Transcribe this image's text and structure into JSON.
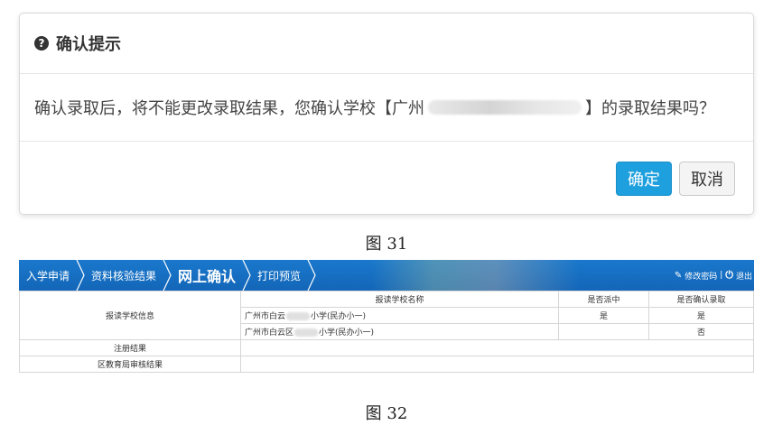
{
  "modal": {
    "icon": "question-circle-icon",
    "title": "确认提示",
    "message_prefix": "确认录取后，将不能更改录取结果，您确认学校【广州",
    "message_suffix": "】的录取结果吗？",
    "confirm_label": "确定",
    "cancel_label": "取消",
    "confirm_color": "#1e9fde"
  },
  "captions": {
    "fig31": "图 31",
    "fig32": "图 32"
  },
  "navbar": {
    "color": "#1a6fc3",
    "crumbs": [
      "入学申请",
      "资料核验结果",
      "网上确认",
      "打印预览"
    ],
    "change_password_label": "修改密码",
    "divider": "|",
    "logout_label": "退出",
    "pencil_icon": "pencil-icon",
    "power_icon": "power-icon"
  },
  "table": {
    "section_school": "报读学校信息",
    "header_name": "报读学校名称",
    "header_assigned": "是否派中",
    "header_confirmed": "是否确认录取",
    "rows": [
      {
        "prefix": "广州市白云",
        "suffix": "小学(民办小一)",
        "assigned": "是",
        "confirmed": "是"
      },
      {
        "prefix": "广州市白云区",
        "suffix": "小学(民办小一)",
        "assigned": "",
        "confirmed": "否"
      }
    ],
    "registration_label": "注册结果",
    "review_label": "区教育局审核结果"
  }
}
